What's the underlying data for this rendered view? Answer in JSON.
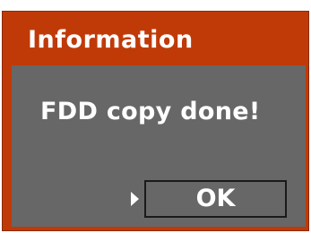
{
  "dialog": {
    "title": "Information",
    "message": "FDD copy done!",
    "ok_label": "OK"
  },
  "icons": {
    "selector": "play-triangle-icon"
  },
  "colors": {
    "title_bar": "#c03a08",
    "body": "#676767",
    "text": "#ffffff"
  }
}
